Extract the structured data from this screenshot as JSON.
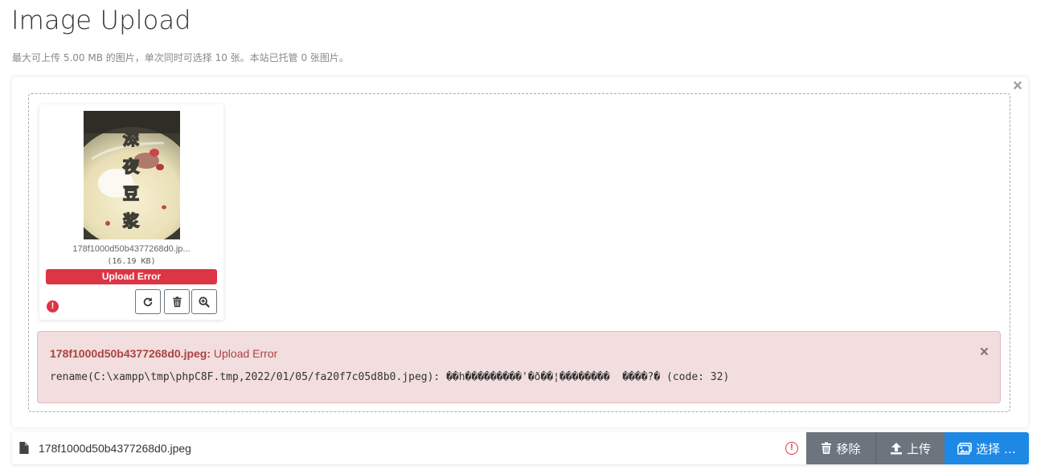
{
  "header": {
    "title": "Image Upload",
    "subtitle": "最大可上传 5.00 MB 的图片，单次同时可选择 10 张。本站已托管 0 张图片。"
  },
  "preview": {
    "file_name": "178f1000d50b4377268d0.jp...",
    "file_size": "(16.19 KB)",
    "status": "Upload Error",
    "error_icon": "!",
    "image_caption": "深夜豆浆",
    "actions": [
      "retry-icon",
      "trash-icon",
      "zoom-in-icon"
    ]
  },
  "error_alert": {
    "file": "178f1000d50b4377268d0.jpeg:",
    "title": "Upload Error",
    "message": "rename(C:\\xampp\\tmp\\phpC8F.tmp,2022/01/05/fa20f7c05d8b0.jpeg): ��h���������'�ð��¦��������  ����?� (code: 32)",
    "close": "×"
  },
  "card_close": "×",
  "bottom_bar": {
    "file_name": "178f1000d50b4377268d0.jpeg",
    "error_icon": "!",
    "remove_label": "移除",
    "upload_label": "上传",
    "browse_label": "选择 …"
  },
  "colors": {
    "danger": "#dc3545",
    "primary": "#1e88e5",
    "secondary": "#6c757d",
    "alert_bg": "#f2dede"
  }
}
